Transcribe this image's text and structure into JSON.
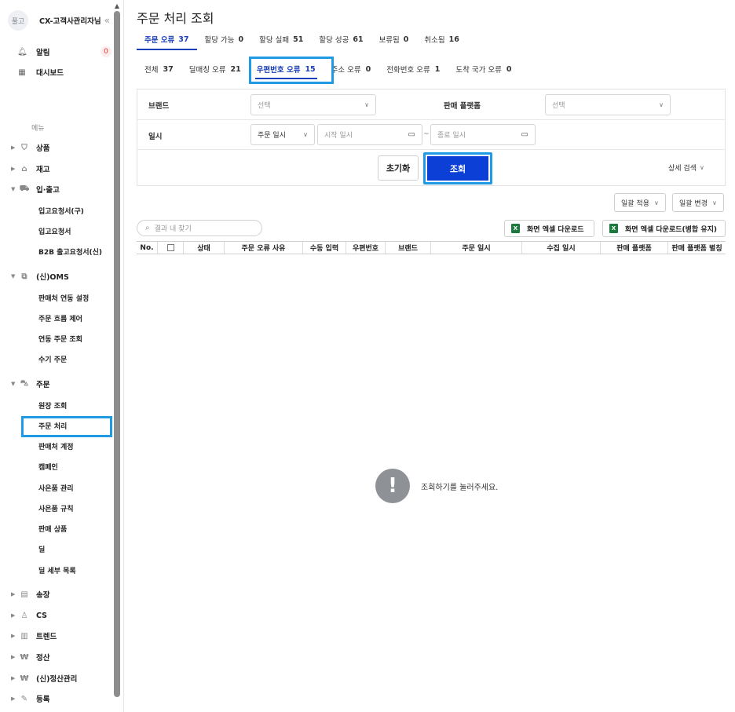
{
  "sidebar": {
    "avatar": "풀고",
    "user": "CX-고객사관리자님",
    "collapse_icon": "«",
    "alerts": {
      "label": "알림",
      "count": "0"
    },
    "dashboard": {
      "label": "대시보드"
    },
    "menu_title": "메뉴",
    "sections": {
      "product": "상품",
      "stock": "재고",
      "inout": "입·출고",
      "oms": "(신)OMS",
      "order": "주문",
      "invoice": "송장",
      "cs": "CS",
      "trend": "트렌드",
      "settle": "정산",
      "settle_new": "(신)정산관리",
      "register": "등록"
    },
    "inout_items": [
      "입고요청서(구)",
      "입고요청서",
      "B2B 출고요청서(신)"
    ],
    "oms_items": [
      "판매처 연동 설정",
      "주문 흐름 제어",
      "연동 주문 조회",
      "수기 주문"
    ],
    "order_items": [
      "원장 조회",
      "주문 처리",
      "판매처 계정",
      "캠페인",
      "사은품 관리",
      "사은품 규칙",
      "판매 상품",
      "딜",
      "딜 세부 목록"
    ],
    "active_item": "주문 처리"
  },
  "main": {
    "title": "주문 처리 조회",
    "tabs1": [
      {
        "label": "주문 오류",
        "count": "37"
      },
      {
        "label": "할당 가능",
        "count": "0"
      },
      {
        "label": "할당 실패",
        "count": "51"
      },
      {
        "label": "할당 성공",
        "count": "61"
      },
      {
        "label": "보류됨",
        "count": "0"
      },
      {
        "label": "취소됨",
        "count": "16"
      }
    ],
    "tabs2": [
      {
        "label": "전체",
        "count": "37"
      },
      {
        "label": "딜매칭 오류",
        "count": "21"
      },
      {
        "label": "우편번호 오류",
        "count": "15"
      },
      {
        "label": "주소 오류",
        "count": "0"
      },
      {
        "label": "전화번호 오류",
        "count": "1"
      },
      {
        "label": "도착 국가 오류",
        "count": "0"
      }
    ],
    "filters": {
      "brand_label": "브랜드",
      "brand_placeholder": "선택",
      "platform_label": "판매 플랫폼",
      "platform_placeholder": "선택",
      "date_label": "일시",
      "date_type": "주문 일시",
      "start_placeholder": "시작 일시",
      "tilde": "~",
      "end_placeholder": "종료 일시",
      "reset": "초기화",
      "search": "조회",
      "advanced": "상세 검색"
    },
    "bulk_apply": "일괄 적용",
    "bulk_change": "일괄 변경",
    "search_in_results": "결과 내 찾기",
    "download_excel": "화면 엑셀 다운로드",
    "download_excel_merge": "화면 엑셀 다운로드(병합 유지)",
    "columns": [
      "No.",
      "",
      "상태",
      "주문 오류 사유",
      "수동 입력",
      "우편번호",
      "브랜드",
      "주문 일시",
      "수집 일시",
      "판매 플랫폼",
      "판매 플랫폼 별칭"
    ],
    "empty_message": "조회하기를 눌러주세요.",
    "accent_color": "#1a3fb8",
    "highlight_color": "#1f9be6"
  }
}
